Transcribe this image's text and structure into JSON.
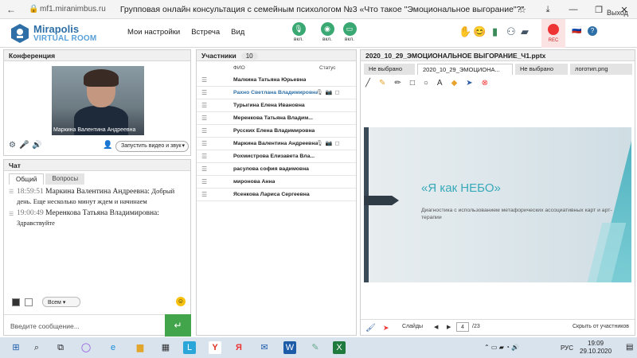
{
  "browser": {
    "url": "mf1.miranimbus.ru",
    "title": "Групповая онлайн консультация с семейным психологом №3 «Что такое \"Эмоциональное выгорание\"?\""
  },
  "app": {
    "logo_line1": "Mirapolis",
    "logo_line2": "VIRTUAL ROOM",
    "menu": [
      "Мои настройки",
      "Встреча",
      "Вид"
    ],
    "controls": [
      {
        "icon": "microphone-icon",
        "label": "вкл."
      },
      {
        "icon": "camera-icon",
        "label": "вкл."
      },
      {
        "icon": "screen-share-icon",
        "label": "вкл."
      }
    ],
    "rec_label": "REC",
    "exit_label": "Выход"
  },
  "conference": {
    "title": "Конференция",
    "video_name": "Маркина Валентина  Андреевна",
    "launch_label": "Запустить видео и звук"
  },
  "chat": {
    "title": "Чат",
    "tabs": [
      "Общий",
      "Вопросы"
    ],
    "messages": [
      {
        "time": "18:59:51",
        "author": "Маркина Валентина  Андреевна:",
        "text": "Добрый день. Еще несколько минут ждем и начинаем"
      },
      {
        "time": "19:00:49",
        "author": "Меренкова  Татьяна  Владимировна:",
        "text": "Здравствуйте"
      }
    ],
    "recipient": "Всем",
    "input_placeholder": "Введите сообщение..."
  },
  "participants": {
    "title": "Участники",
    "count": "10",
    "col_name": "ФИО",
    "col_status": "Статус",
    "rows": [
      {
        "name": "Малкина Татьяна  Юрьевна",
        "highlight": false,
        "status": ""
      },
      {
        "name": "Рахно Светлана  Владимировна",
        "highlight": true,
        "status": "🎙📷◻"
      },
      {
        "name": "Турыгина  Елена  Ивановна",
        "highlight": false,
        "status": ""
      },
      {
        "name": "Меренкова  Татьяна  Владим...",
        "highlight": false,
        "status": ""
      },
      {
        "name": "Русских Елена Владимировна",
        "highlight": false,
        "status": ""
      },
      {
        "name": "Маркина Валентина  Андреевна",
        "highlight": false,
        "status": "🎙📷◻"
      },
      {
        "name": "Рохмистрова  Елизавета Вла...",
        "highlight": false,
        "status": ""
      },
      {
        "name": "расулова  софия вадимовна",
        "highlight": false,
        "status": ""
      },
      {
        "name": "миронова  Анна",
        "highlight": false,
        "status": ""
      },
      {
        "name": "Ясенкова Лариса  Сергеевна",
        "highlight": false,
        "status": ""
      }
    ]
  },
  "document": {
    "title": "2020_10_29_ЭМОЦИОНАЛЬНОЕ ВЫГОРАНИЕ_Ч1.pptx",
    "tabs": [
      "Не выбрано",
      "2020_10_29_ЭМОЦИОНА...",
      "Не выбрано",
      "логотип.png"
    ],
    "active_tab": 1,
    "slide_title": "«Я как НЕБО»",
    "slide_subtitle": "Диагностика с использованием метафорических ассоциативных карт и арт-терапии",
    "slides_label": "Слайды",
    "page": "4",
    "total": "/23",
    "hide_label": "Скрыть от участников"
  },
  "taskbar": {
    "lang": "РУС",
    "time": "19:09",
    "date": "29.10.2020"
  }
}
